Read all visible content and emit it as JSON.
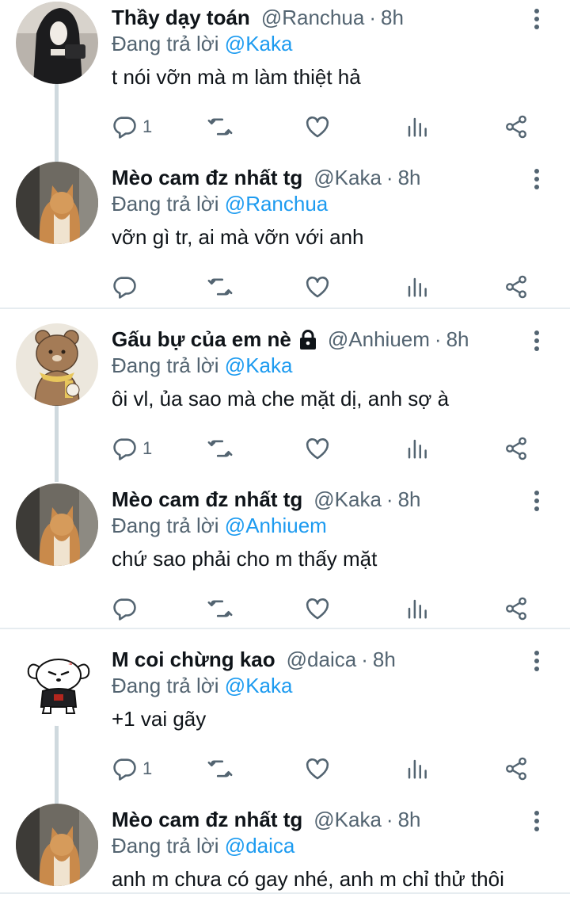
{
  "tweets": [
    {
      "name": "Thầy dạy toán",
      "handle": "@Ranchua",
      "time": "8h",
      "reply_prefix": "Đang trả lời",
      "reply_to": "@Kaka",
      "text": "t nói vỡn mà m làm thiệt hả",
      "reply_count": "1",
      "locked": false,
      "avatar": "dark-hooded-person-avatar"
    },
    {
      "name": "Mèo cam đz nhất tg",
      "handle": "@Kaka",
      "time": "8h",
      "reply_prefix": "Đang trả lời",
      "reply_to": "@Ranchua",
      "text": "vỡn gì tr, ai mà vỡn với anh",
      "reply_count": "",
      "locked": false,
      "avatar": "orange-cat-avatar"
    },
    {
      "name": "Gấu bự của em nè",
      "handle": "@Anhiuem",
      "time": "8h",
      "reply_prefix": "Đang trả lời",
      "reply_to": "@Kaka",
      "text": "ôi vl, ủa sao mà che mặt dị, anh sợ à",
      "reply_count": "1",
      "locked": true,
      "avatar": "brown-bear-drawing-avatar"
    },
    {
      "name": "Mèo cam đz nhất tg",
      "handle": "@Kaka",
      "time": "8h",
      "reply_prefix": "Đang trả lời",
      "reply_to": "@Anhiuem",
      "text": "chứ sao phải cho m thấy mặt",
      "reply_count": "",
      "locked": false,
      "avatar": "orange-cat-avatar"
    },
    {
      "name": "M coi chừng kao",
      "handle": "@daica",
      "time": "8h",
      "reply_prefix": "Đang trả lời",
      "reply_to": "@Kaka",
      "text": "+1 vai gãy",
      "reply_count": "1",
      "locked": false,
      "avatar": "angry-white-dog-drawing-avatar"
    },
    {
      "name": "Mèo cam đz nhất tg",
      "handle": "@Kaka",
      "time": "8h",
      "reply_prefix": "Đang trả lời",
      "reply_to": "@daica",
      "text": "anh m chưa có gay nhé, anh m chỉ thử thôi",
      "reply_count": "",
      "locked": false,
      "avatar": "orange-cat-avatar"
    }
  ],
  "colors": {
    "text": "#0f1419",
    "secondary": "#536471",
    "mention": "#1d9bf0",
    "thread_line": "#cfd9de",
    "divider": "#e6ecf0"
  },
  "icons": [
    "reply-icon",
    "retweet-icon",
    "like-icon",
    "views-icon",
    "share-icon",
    "more-icon",
    "lock-icon"
  ]
}
